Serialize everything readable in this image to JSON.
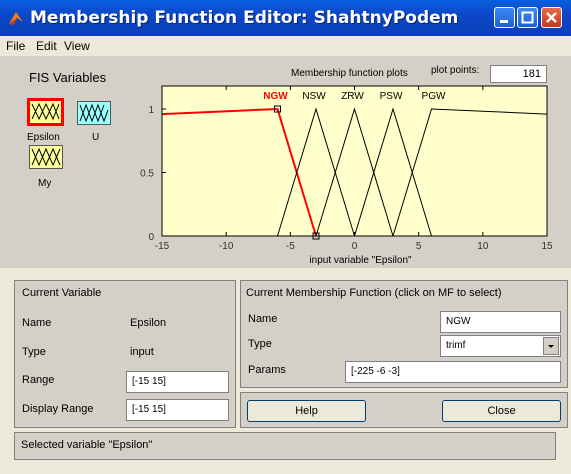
{
  "window": {
    "title": "Membership Function Editor: ShahtnyPodem"
  },
  "menu": [
    "File",
    "Edit",
    "View"
  ],
  "fis_variables": {
    "heading": "FIS Variables",
    "inputs": [
      {
        "label": "Epsilon",
        "selected": true
      }
    ],
    "outputs": [
      {
        "label": "U"
      },
      {
        "label": "My"
      }
    ]
  },
  "plot": {
    "title": "Membership function plots",
    "plot_points_label": "plot points:",
    "plot_points_value": "181",
    "xlabel": "input variable \"Epsilon\"",
    "xlim": [
      -15,
      15
    ],
    "ylim": [
      0,
      1
    ],
    "xticks": [
      "-15",
      "-10",
      "-5",
      "0",
      "5",
      "10",
      "15"
    ],
    "yticks": [
      "0",
      "0.5",
      "1"
    ],
    "selected_color": "#ff0000",
    "plot_bg": "#ffffcc"
  },
  "chart_data": {
    "type": "line",
    "xlabel": "input variable \"Epsilon\"",
    "xlim": [
      -15,
      15
    ],
    "ylim": [
      0,
      1
    ],
    "series": [
      {
        "name": "NGW",
        "params": [
          -225,
          -6,
          -3
        ],
        "points": [
          [
            -15,
            0.96
          ],
          [
            -6,
            1
          ],
          [
            -3,
            0
          ]
        ],
        "selected": true
      },
      {
        "name": "NSW",
        "params": [
          -6,
          -3,
          0
        ],
        "points": [
          [
            -6,
            0
          ],
          [
            -3,
            1
          ],
          [
            0,
            0
          ]
        ]
      },
      {
        "name": "ZRW",
        "params": [
          -3,
          0,
          3
        ],
        "points": [
          [
            -3,
            0
          ],
          [
            0,
            1
          ],
          [
            3,
            0
          ]
        ]
      },
      {
        "name": "PSW",
        "params": [
          0,
          3,
          6
        ],
        "points": [
          [
            0,
            0
          ],
          [
            3,
            1
          ],
          [
            6,
            0
          ]
        ]
      },
      {
        "name": "PGW",
        "params": [
          3,
          6,
          225
        ],
        "points": [
          [
            3,
            0
          ],
          [
            6,
            1
          ],
          [
            15,
            0.96
          ]
        ]
      }
    ]
  },
  "current_variable": {
    "heading": "Current Variable",
    "name_label": "Name",
    "name_value": "Epsilon",
    "type_label": "Type",
    "type_value": "input",
    "range_label": "Range",
    "range_value": "[-15 15]",
    "display_range_label": "Display Range",
    "display_range_value": "[-15 15]"
  },
  "current_mf": {
    "heading": "Current Membership Function (click on MF to select)",
    "name_label": "Name",
    "name_value": "NGW",
    "type_label": "Type",
    "type_value": "trimf",
    "params_label": "Params",
    "params_value": "[-225 -6 -3]"
  },
  "buttons": {
    "help": "Help",
    "close": "Close"
  },
  "status": "Selected variable \"Epsilon\""
}
